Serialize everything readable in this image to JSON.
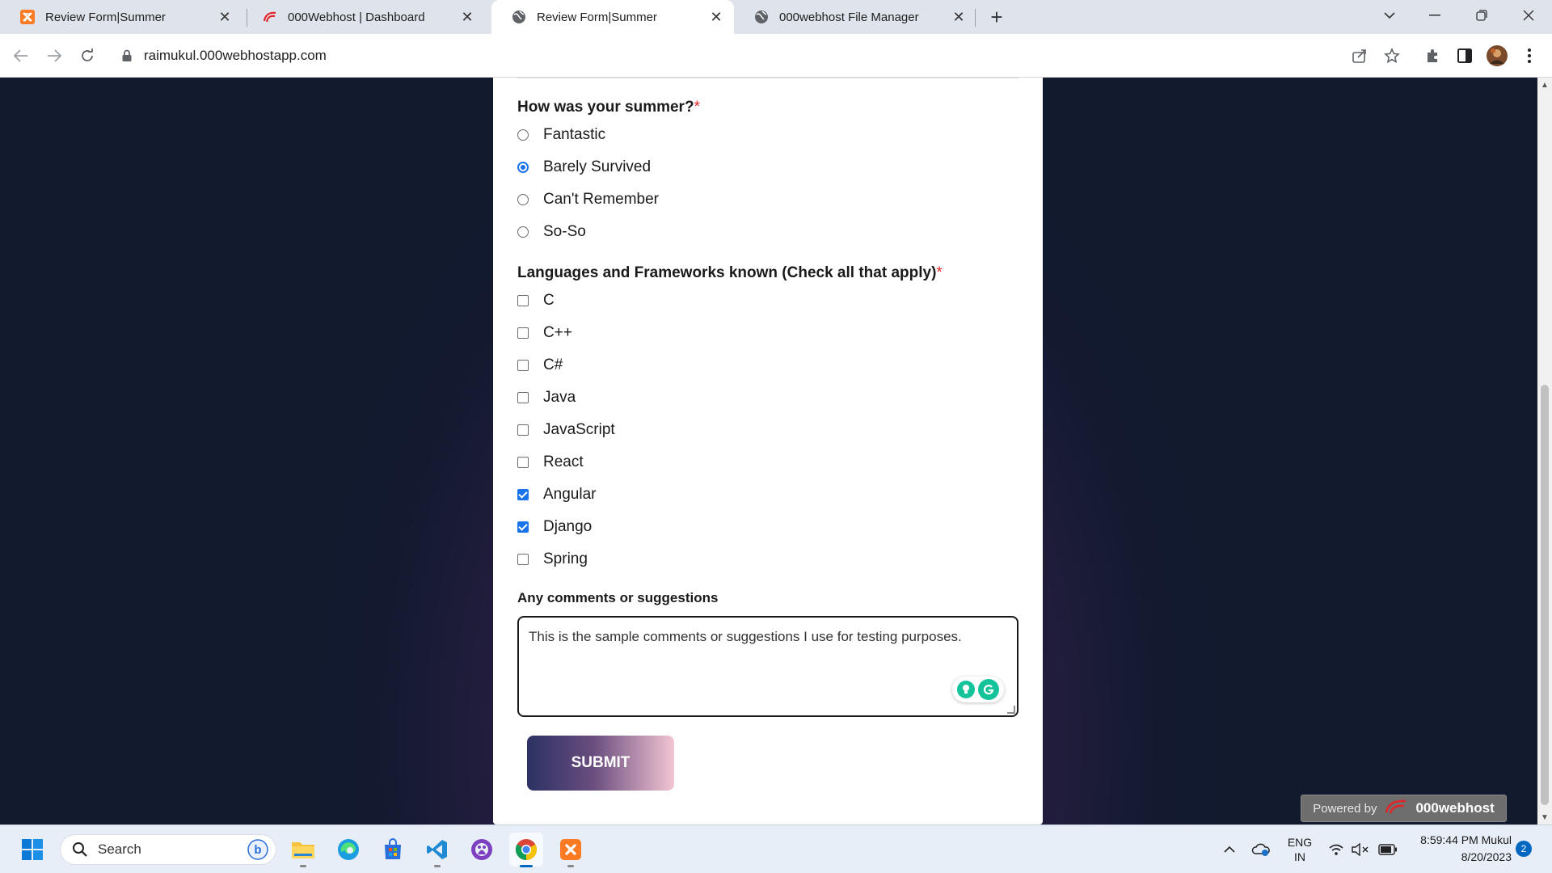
{
  "browser": {
    "tabs": [
      {
        "title": "Review Form|Summer",
        "icon": "xampp-icon",
        "active": false
      },
      {
        "title": "000Webhost | Dashboard",
        "icon": "000webhost-icon",
        "active": false
      },
      {
        "title": "Review Form|Summer",
        "icon": "globe-icon",
        "active": true
      },
      {
        "title": "000webhost File Manager",
        "icon": "globe-icon",
        "active": false
      }
    ],
    "url": "raimukul.000webhostapp.com"
  },
  "form": {
    "summer_question": "How was your summer?",
    "required_mark": "*",
    "summer_options": [
      {
        "label": "Fantastic",
        "selected": false
      },
      {
        "label": "Barely Survived",
        "selected": true
      },
      {
        "label": "Can't Remember",
        "selected": false
      },
      {
        "label": "So-So",
        "selected": false
      }
    ],
    "languages_question": "Languages and Frameworks known (Check all that apply)",
    "languages": [
      {
        "label": "C",
        "checked": false
      },
      {
        "label": "C++",
        "checked": false
      },
      {
        "label": "C#",
        "checked": false
      },
      {
        "label": "Java",
        "checked": false
      },
      {
        "label": "JavaScript",
        "checked": false
      },
      {
        "label": "React",
        "checked": false
      },
      {
        "label": "Angular",
        "checked": true
      },
      {
        "label": "Django",
        "checked": true
      },
      {
        "label": "Spring",
        "checked": false
      }
    ],
    "comments_label": "Any comments or suggestions",
    "comments_value": "This is the sample comments or suggestions I use for testing purposes.",
    "submit_label": "SUBMIT"
  },
  "badge": {
    "powered_by": "Powered by",
    "brand": "000webhost"
  },
  "taskbar": {
    "search_label": "Search",
    "lang_line1": "ENG",
    "lang_line2": "IN",
    "time": "8:59:44 PM Mukul",
    "date": "8/20/2023",
    "notification_count": "2"
  },
  "colors": {
    "accent": "#1a73e8",
    "required": "#e0262a",
    "page_background": "#121a2e"
  }
}
